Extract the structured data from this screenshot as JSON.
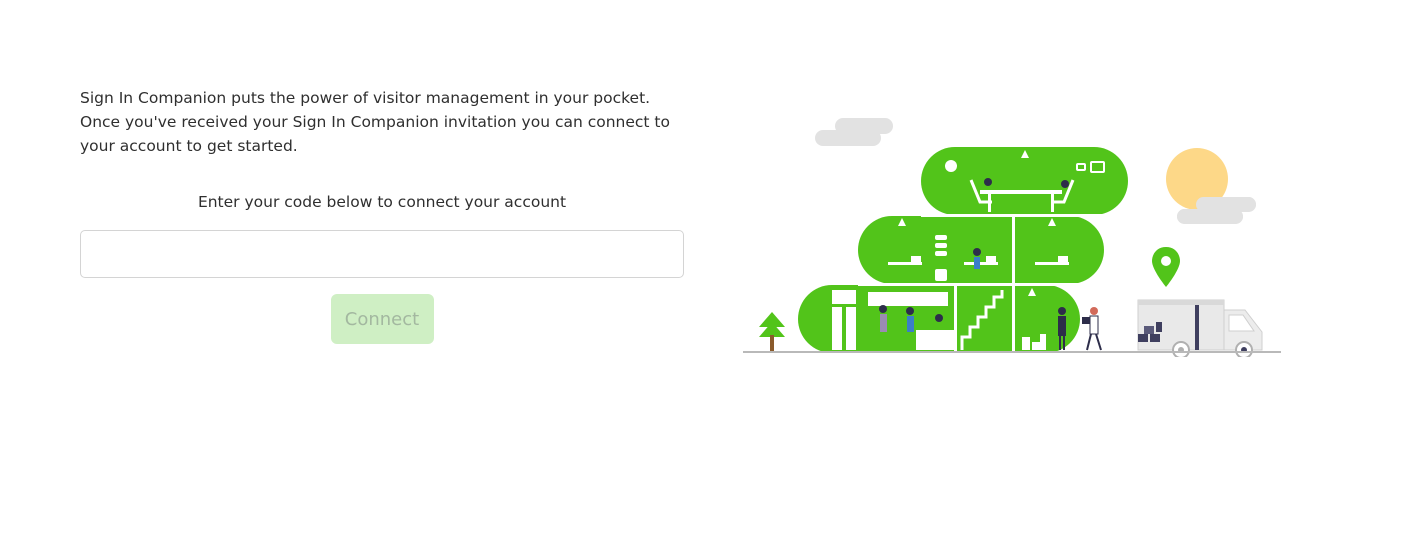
{
  "intro": {
    "text": "Sign In Companion puts the power of visitor management in your pocket. Once you've received your Sign In Companion invitation you can connect to your account to get started."
  },
  "connect_form": {
    "prompt": "Enter your code below to connect your account",
    "code_value": "",
    "code_placeholder": "",
    "connect_label": "Connect"
  },
  "colors": {
    "brand_green": "#52c41a",
    "button_disabled_bg": "#cfefc4",
    "button_disabled_text": "#a3b8a0",
    "cloud_gray": "#e2e2e2",
    "sun_yellow": "#fdd888",
    "ground_gray": "#b9b9b9"
  },
  "illustration": {
    "icon": "office-building-illustration"
  }
}
